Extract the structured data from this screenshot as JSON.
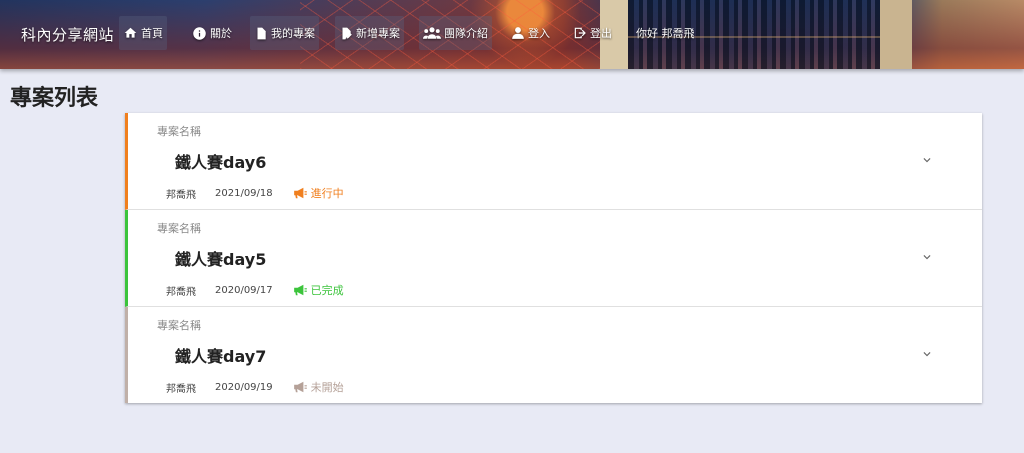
{
  "header": {
    "brand": "科內分享網站",
    "nav": [
      {
        "label": "首頁",
        "icon": "home-icon"
      },
      {
        "label": "關於",
        "icon": "info-icon"
      },
      {
        "label": "我的專案",
        "icon": "document-icon"
      },
      {
        "label": "新增專案",
        "icon": "edit-document-icon"
      },
      {
        "label": "團隊介紹",
        "icon": "group-icon"
      },
      {
        "label": "登入",
        "icon": "person-icon"
      },
      {
        "label": "登出",
        "icon": "logout-icon"
      }
    ],
    "greeting": "你好 邦喬飛"
  },
  "page": {
    "title": "專案列表"
  },
  "projects": [
    {
      "caption": "專案名稱",
      "name": "鐵人賽day6",
      "owner": "邦喬飛",
      "date": "2021/09/18",
      "status": "進行中",
      "status_color": "#f07f1e",
      "icon": "megaphone-icon"
    },
    {
      "caption": "專案名稱",
      "name": "鐵人賽day5",
      "owner": "邦喬飛",
      "date": "2020/09/17",
      "status": "已完成",
      "status_color": "#3cc43c",
      "icon": "megaphone-icon"
    },
    {
      "caption": "專案名稱",
      "name": "鐵人賽day7",
      "owner": "邦喬飛",
      "date": "2020/09/19",
      "status": "未開始",
      "status_color": "#b5a198",
      "icon": "megaphone-icon"
    }
  ]
}
